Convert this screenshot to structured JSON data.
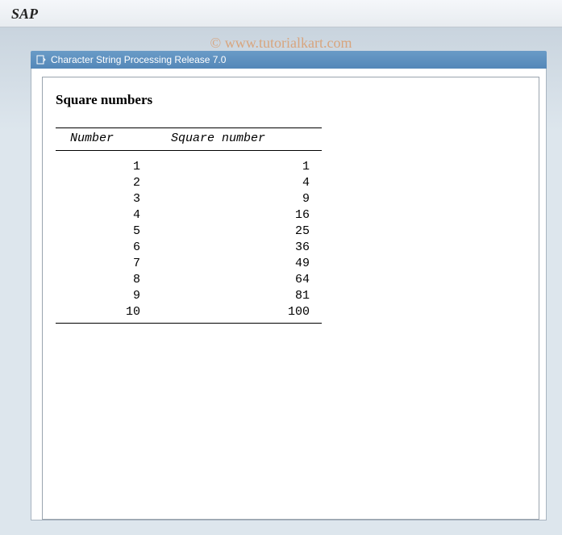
{
  "app": {
    "logo": "SAP"
  },
  "watermark": "© www.tutorialkart.com",
  "window": {
    "title": "Character String Processing Release 7.0"
  },
  "report": {
    "heading": "Square numbers",
    "headers": {
      "col1": "Number",
      "col2": "Square number"
    }
  },
  "chart_data": {
    "type": "table",
    "columns": [
      "Number",
      "Square number"
    ],
    "rows": [
      {
        "number": "1",
        "square": "1"
      },
      {
        "number": "2",
        "square": "4"
      },
      {
        "number": "3",
        "square": "9"
      },
      {
        "number": "4",
        "square": "16"
      },
      {
        "number": "5",
        "square": "25"
      },
      {
        "number": "6",
        "square": "36"
      },
      {
        "number": "7",
        "square": "49"
      },
      {
        "number": "8",
        "square": "64"
      },
      {
        "number": "9",
        "square": "81"
      },
      {
        "number": "10",
        "square": "100"
      }
    ]
  }
}
